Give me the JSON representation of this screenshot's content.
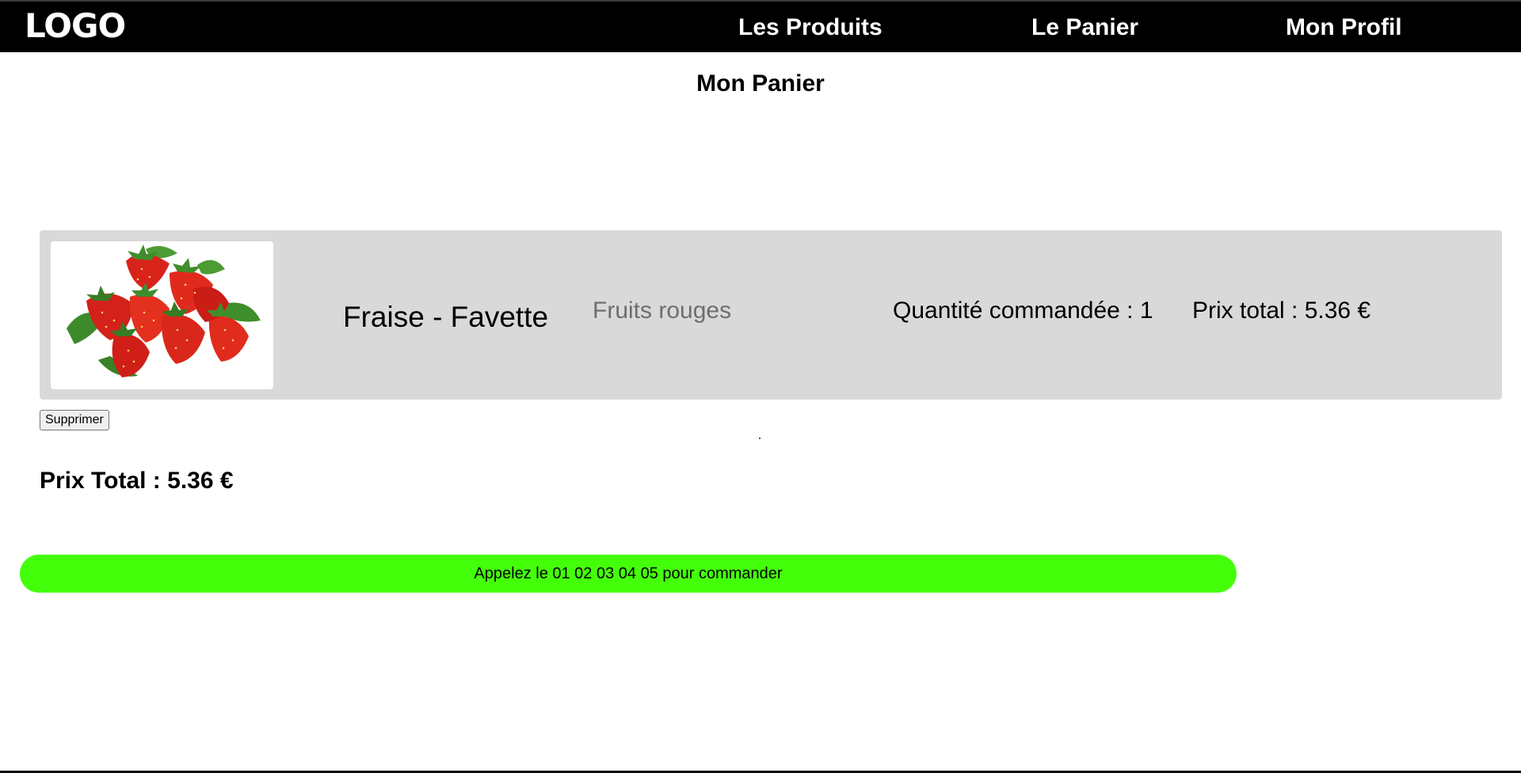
{
  "header": {
    "logo_text": "LOGO",
    "nav": {
      "products": "Les Produits",
      "cart": "Le Panier",
      "profile": "Mon Profil"
    }
  },
  "page": {
    "title": "Mon Panier"
  },
  "cart": {
    "items": [
      {
        "image_icon": "strawberries-image",
        "name": "Fraise - Favette",
        "category": "Fruits rouges",
        "quantity_text": "Quantité commandée : 1",
        "quantity": 1,
        "total_text": "Prix total : 5.36 €",
        "total": 5.36
      }
    ],
    "delete_label": "Supprimer",
    "grand_total_text": "Prix Total : 5.36 €",
    "grand_total": 5.36
  },
  "order_banner": {
    "text": "Appelez le 01 02 03 04 05 pour commander",
    "color": "#44ff0a"
  },
  "colors": {
    "navbar": "#000000",
    "card_background": "#d9d9d9",
    "category_text": "#6e6e6e"
  }
}
